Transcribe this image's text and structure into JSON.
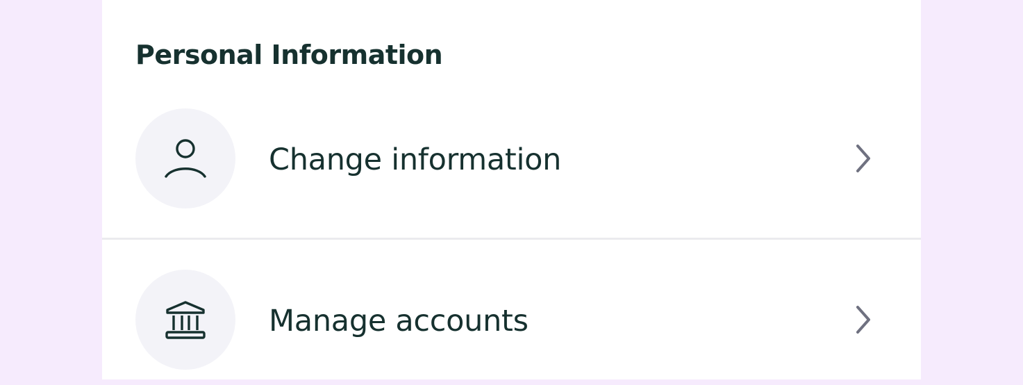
{
  "section": {
    "title": "Personal Information"
  },
  "items": [
    {
      "label": "Change information",
      "icon": "user-icon"
    },
    {
      "label": "Manage accounts",
      "icon": "bank-icon"
    }
  ],
  "colors": {
    "background": "#f6ebfd",
    "panel": "#ffffff",
    "text": "#16312f",
    "icon_circle": "#f3f3f8",
    "chevron": "#6f7180",
    "divider": "#ebebee"
  }
}
